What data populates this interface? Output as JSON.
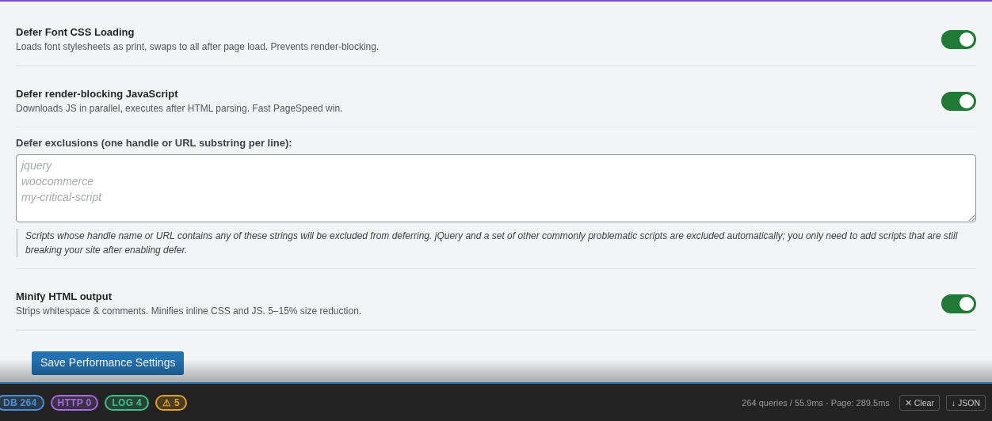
{
  "groups": [
    {
      "settings": [
        {
          "kind": "toggle",
          "title": "Defer Font CSS Loading",
          "description": "Loads font stylesheets as print, swaps to all after page load. Prevents render-blocking.",
          "on": true
        }
      ]
    },
    {
      "settings": [
        {
          "kind": "toggle",
          "title": "Defer render-blocking JavaScript",
          "description": "Downloads JS in parallel, executes after HTML parsing. Fast PageSpeed win.",
          "on": true
        },
        {
          "kind": "textarea",
          "label": "Defer exclusions (one handle or URL substring per line):",
          "placeholder": "jquery\nwoocommerce\nmy-critical-script",
          "note": "Scripts whose handle name or URL contains any of these strings will be excluded from deferring. jQuery and a set of other commonly problematic scripts are excluded automatically; you only need to add scripts that are still breaking your site after enabling defer."
        }
      ]
    },
    {
      "settings": [
        {
          "kind": "toggle",
          "title": "Minify HTML output",
          "description": "Strips whitespace & comments. Minifies inline CSS and JS. 5–15% size reduction.",
          "on": true
        }
      ]
    }
  ],
  "save_button": "Save Performance Settings",
  "debug_bar": {
    "badges": [
      {
        "label": "DB",
        "count": "264",
        "color": "#4a90d9"
      },
      {
        "label": "HTTP",
        "count": "0",
        "color": "#a66be0"
      },
      {
        "label": "LOG",
        "count": "4",
        "color": "#3fbf8a"
      },
      {
        "label": "⚠",
        "count": "5",
        "color": "#e0a020"
      }
    ],
    "summary": "264 queries / 55.9ms · Page: 289.5ms",
    "buttons": [
      "✕ Clear",
      "↓ JSON"
    ]
  }
}
